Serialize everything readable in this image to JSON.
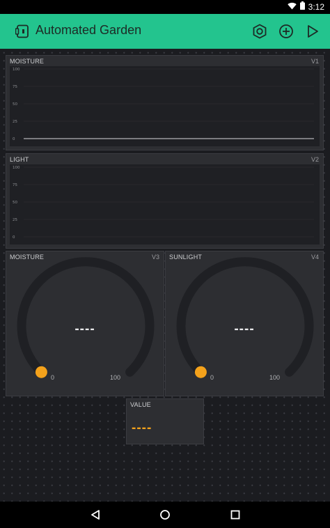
{
  "status_bar": {
    "time": "3:12",
    "icons": [
      "wifi-icon",
      "battery-icon"
    ]
  },
  "app_bar": {
    "title": "Automated Garden",
    "actions": [
      "settings-icon",
      "add-icon",
      "play-icon"
    ],
    "color": "#23c48e"
  },
  "widgets": {
    "moisture_chart": {
      "title": "MOISTURE",
      "pin": "V1",
      "chart_data": {
        "type": "line",
        "title": "MOISTURE",
        "y_ticks": [
          "100",
          "75",
          "50",
          "25",
          "0"
        ],
        "ylim": [
          0,
          100
        ],
        "series": [
          {
            "values": [
              0,
              0
            ]
          }
        ],
        "grid": true
      }
    },
    "light_chart": {
      "title": "LIGHT",
      "pin": "V2",
      "chart_data": {
        "type": "line",
        "title": "LIGHT",
        "y_ticks": [
          "100",
          "75",
          "50",
          "25",
          "0"
        ],
        "ylim": [
          0,
          100
        ],
        "series": [],
        "grid": true
      }
    },
    "moisture_gauge": {
      "title": "MOISTURE",
      "pin": "V3",
      "value": "----",
      "min": "0",
      "max": "100",
      "level": 0
    },
    "sunlight_gauge": {
      "title": "SUNLIGHT",
      "pin": "V4",
      "value": "----",
      "min": "0",
      "max": "100",
      "level": 0
    },
    "value_display": {
      "title": "VALUE",
      "value": "----"
    }
  },
  "accent_color": "#f4a21b",
  "nav_bar": [
    "back-icon",
    "home-icon",
    "recents-icon"
  ]
}
